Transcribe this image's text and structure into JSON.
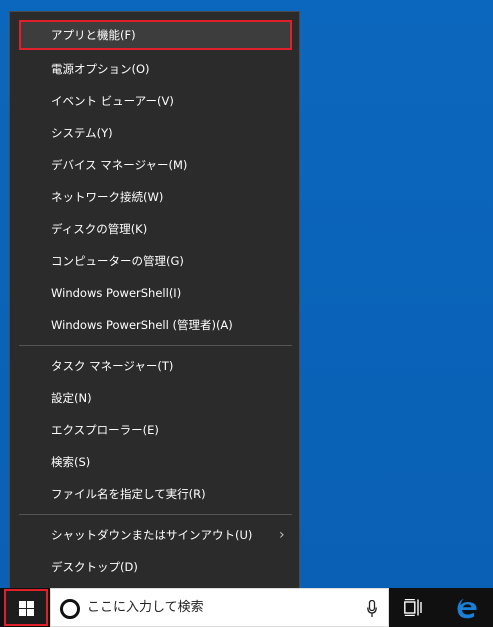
{
  "context_menu": {
    "items": [
      {
        "label": "アプリと機能(F)"
      },
      {
        "label": "電源オプション(O)"
      },
      {
        "label": "イベント ビューアー(V)"
      },
      {
        "label": "システム(Y)"
      },
      {
        "label": "デバイス マネージャー(M)"
      },
      {
        "label": "ネットワーク接続(W)"
      },
      {
        "label": "ディスクの管理(K)"
      },
      {
        "label": "コンピューターの管理(G)"
      },
      {
        "label": "Windows PowerShell(I)"
      },
      {
        "label": "Windows PowerShell (管理者)(A)"
      },
      {
        "label": "タスク マネージャー(T)"
      },
      {
        "label": "設定(N)"
      },
      {
        "label": "エクスプローラー(E)"
      },
      {
        "label": "検索(S)"
      },
      {
        "label": "ファイル名を指定して実行(R)"
      },
      {
        "label": "シャットダウンまたはサインアウト(U)",
        "submenu_arrow": "›"
      },
      {
        "label": "デスクトップ(D)"
      }
    ]
  },
  "taskbar": {
    "search_placeholder": "ここに入力して検索",
    "icons": {
      "start": "windows-logo-icon",
      "search": "cortana-icon",
      "mic": "microphone-icon",
      "task_view": "task-view-icon",
      "browser": "edge-icon"
    }
  },
  "colors": {
    "desktop": "#0a63b8",
    "menu_bg": "#2b2b2b",
    "highlight_border": "#e0202a",
    "taskbar_bg": "#101010",
    "edge_blue": "#1a7fd7"
  }
}
